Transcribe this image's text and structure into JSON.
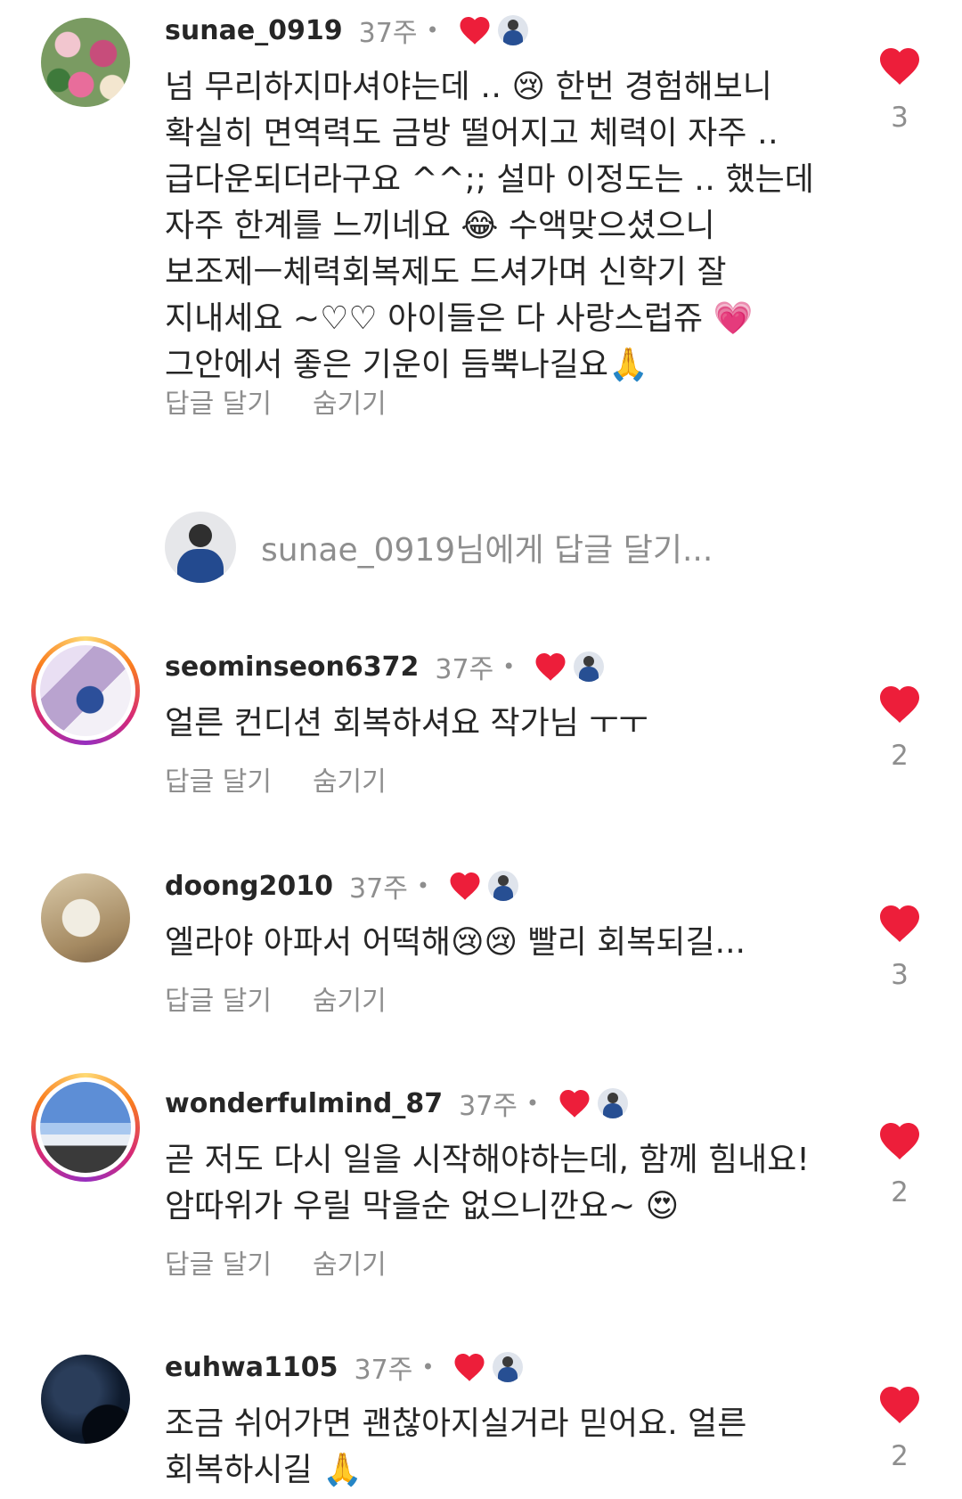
{
  "comments": [
    {
      "username": "sunae_0919",
      "time": "37주",
      "text": "넘 무리하지마셔야는데 ‥ 😢 한번 경험해보니\n확실히 면역력도 금방 떨어지고 체력이 자주 ‥\n급다운되더라구요 ^^;; 설마 이정도는 ‥ 했는데\n자주 한계를 느끼네요 😂 수액맞으셨으니\n보조제ㅡ체력회복제도 드셔가며 신학기 잘\n지내세요 ~♡♡ 아이들은 다 사랑스럽쥬 💗\n그안에서 좋은 기운이 듬뿍나길요🙏",
      "reply_label": "답글 달기",
      "hide_label": "숨기기",
      "likes": "3",
      "avatar_colors": [
        "#c74d7b",
        "#f2c6cf",
        "#3e7a3b"
      ]
    },
    {
      "username": "seominseon6372",
      "time": "37주",
      "text": "얼른 컨디션 회복하셔요 작가님 ㅜㅜ",
      "reply_label": "답글 달기",
      "hide_label": "숨기기",
      "likes": "2",
      "avatar_colors": [
        "#b9a3cf",
        "#2c4f9a",
        "#ffffff"
      ]
    },
    {
      "username": "doong2010",
      "time": "37주",
      "text": "엘라야 아파서 어떡해😢😢 빨리 회복되길...",
      "reply_label": "답글 달기",
      "hide_label": "숨기기",
      "likes": "3",
      "avatar_colors": [
        "#f1ede2",
        "#a58a62",
        "#5e4a33"
      ]
    },
    {
      "username": "wonderfulmind_87",
      "time": "37주",
      "text": "곧 저도 다시 일을 시작해야하는데, 함께 힘내요!\n암따위가 우릴 막을순 없으니깐요~ 😍",
      "reply_label": "답글 달기",
      "hide_label": "숨기기",
      "likes": "2",
      "avatar_colors": [
        "#5d8ed6",
        "#a9c8ef",
        "#3a3a3a"
      ]
    },
    {
      "username": "euhwa1105",
      "time": "37주",
      "text": "조금 쉬어가면 괜찮아지실거라 믿어요. 얼른\n회복하시길 🙏",
      "reply_label": "답글 달기",
      "hide_label": "숨기기",
      "likes": "2",
      "avatar_colors": [
        "#0e1a2c",
        "#2a3d5a",
        "#050a12"
      ]
    }
  ],
  "reply_input": {
    "placeholder": "sunae_0919님에게 답글 달기..."
  },
  "colors": {
    "heart": "#ed1e3a",
    "muted": "#8e8e8e",
    "text": "#262626"
  }
}
